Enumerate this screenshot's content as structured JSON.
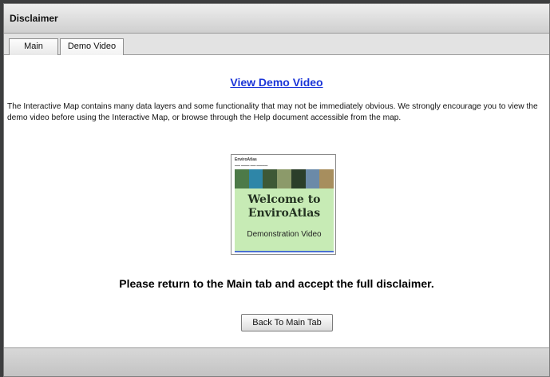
{
  "dialog": {
    "title": "Disclaimer"
  },
  "tabs": [
    {
      "label": "Main",
      "active": false
    },
    {
      "label": "Demo Video",
      "active": true
    }
  ],
  "content": {
    "link_text": "View Demo Video",
    "paragraph": "The Interactive Map contains many data layers and some functionality that may not be immediately obvious. We strongly encourage you to view the demo video before using the Interactive Map, or browse through the Help document accessible from the map.",
    "thumbnail": {
      "header": "EnviroAtlas",
      "title_line1": "Welcome to",
      "title_line2": "EnviroAtlas",
      "subtitle": "Demonstration Video"
    },
    "instruction": "Please return to the Main tab and accept the full disclaimer.",
    "back_button": "Back To Main Tab"
  },
  "colors": {
    "link": "#1b35d8",
    "thumbnail_background": "#c7ebb5",
    "page_backdrop": "#3d3e3f"
  }
}
